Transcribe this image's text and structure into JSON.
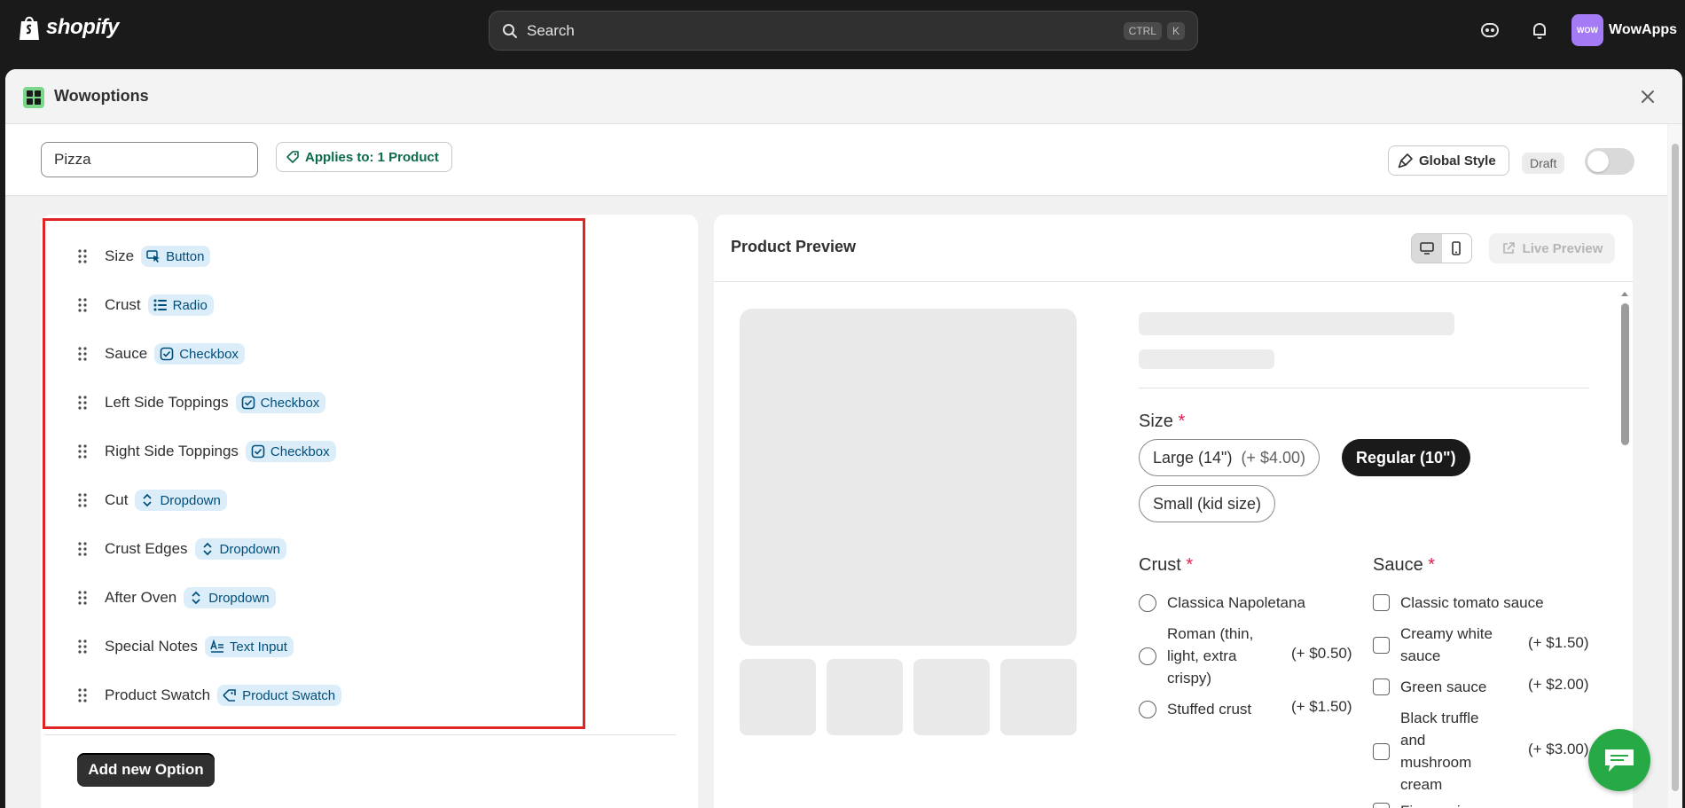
{
  "topbar": {
    "brand": "shopify",
    "search_placeholder": "Search",
    "shortcut_key1": "CTRL",
    "shortcut_key2": "K",
    "avatar_initials": "WOW",
    "store_name": "WowApps"
  },
  "modal": {
    "title": "Wowoptions",
    "set_name": "Pizza",
    "applies_label": "Applies to: 1 Product",
    "global_style_label": "Global Style",
    "status_label": "Draft",
    "published": false
  },
  "options": [
    {
      "label": "Size",
      "type": "Button",
      "icon": "cursor-click-icon"
    },
    {
      "label": "Crust",
      "type": "Radio",
      "icon": "list-icon"
    },
    {
      "label": "Sauce",
      "type": "Checkbox",
      "icon": "checkbox-icon"
    },
    {
      "label": "Left Side Toppings",
      "type": "Checkbox",
      "icon": "checkbox-icon"
    },
    {
      "label": "Right Side Toppings",
      "type": "Checkbox",
      "icon": "checkbox-icon"
    },
    {
      "label": "Cut",
      "type": "Dropdown",
      "icon": "select-chevrons-icon"
    },
    {
      "label": "Crust Edges",
      "type": "Dropdown",
      "icon": "select-chevrons-icon"
    },
    {
      "label": "After Oven",
      "type": "Dropdown",
      "icon": "select-chevrons-icon"
    },
    {
      "label": "Special Notes",
      "type": "Text Input",
      "icon": "text-input-icon"
    },
    {
      "label": "Product Swatch",
      "type": "Product Swatch",
      "icon": "tag-icon"
    }
  ],
  "add_option_label": "Add new Option",
  "preview": {
    "title": "Product Preview",
    "live_preview_label": "Live Preview",
    "size": {
      "title": "Size",
      "required_mark": "*",
      "choices": [
        {
          "label": "Large (14\")",
          "price": "(+ $4.00)",
          "selected": false
        },
        {
          "label": "Regular (10\")",
          "price": "",
          "selected": true
        },
        {
          "label": "Small (kid size)",
          "price": "",
          "selected": false
        }
      ]
    },
    "crust": {
      "title": "Crust",
      "required_mark": "*",
      "choices": [
        {
          "label": "Classica Napoletana",
          "price": ""
        },
        {
          "label": "Roman (thin, light, extra crispy)",
          "price": "(+ $0.50)"
        },
        {
          "label": "Stuffed crust",
          "price": "(+ $1.50)"
        }
      ]
    },
    "sauce": {
      "title": "Sauce",
      "required_mark": "*",
      "choices": [
        {
          "label": "Classic tomato sauce",
          "price": ""
        },
        {
          "label": "Creamy white sauce",
          "price": "(+ $1.50)"
        },
        {
          "label": "Green sauce",
          "price": "(+ $2.00)"
        },
        {
          "label": "Black truffle and mushroom cream",
          "price": "(+ $3.00)"
        },
        {
          "label": "Fiery, spicy",
          "price": ""
        }
      ]
    }
  },
  "colors": {
    "highlight": "#e02424",
    "badge_bg": "#dcedfa",
    "badge_text": "#004e7a",
    "accent_green": "#27a945"
  }
}
